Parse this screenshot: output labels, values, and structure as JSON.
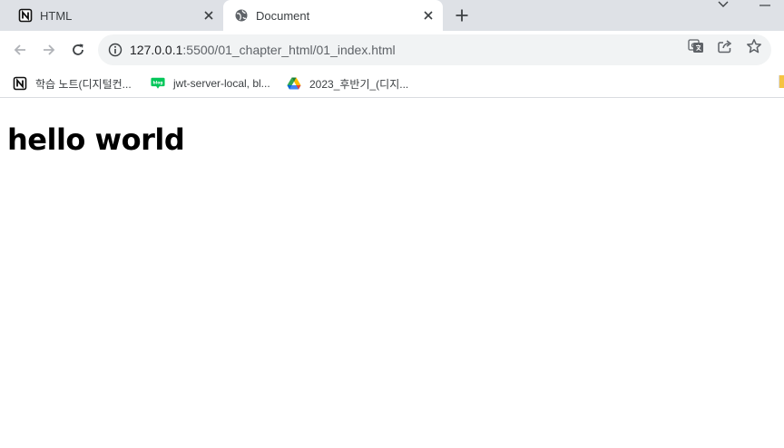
{
  "tabs": [
    {
      "title": "HTML",
      "icon": "notion-icon",
      "active": false
    },
    {
      "title": "Document",
      "icon": "globe-icon",
      "active": true
    }
  ],
  "new_tab_label": "+",
  "address_bar": {
    "host": "127.0.0.1",
    "path": ":5500/01_chapter_html/01_index.html"
  },
  "bookmarks": [
    {
      "label": "학습 노트(디지털컨...",
      "icon": "notion-icon"
    },
    {
      "label": "jwt-server-local, bl...",
      "icon": "blog-icon",
      "icon_text": "blog"
    },
    {
      "label": "2023_후반기_(디지...",
      "icon": "google-drive-icon"
    }
  ],
  "page": {
    "heading": "hello world"
  },
  "colors": {
    "tabstrip_bg": "#dee1e6",
    "omnibox_bg": "#f1f3f4",
    "blog_green": "#03c75a"
  }
}
